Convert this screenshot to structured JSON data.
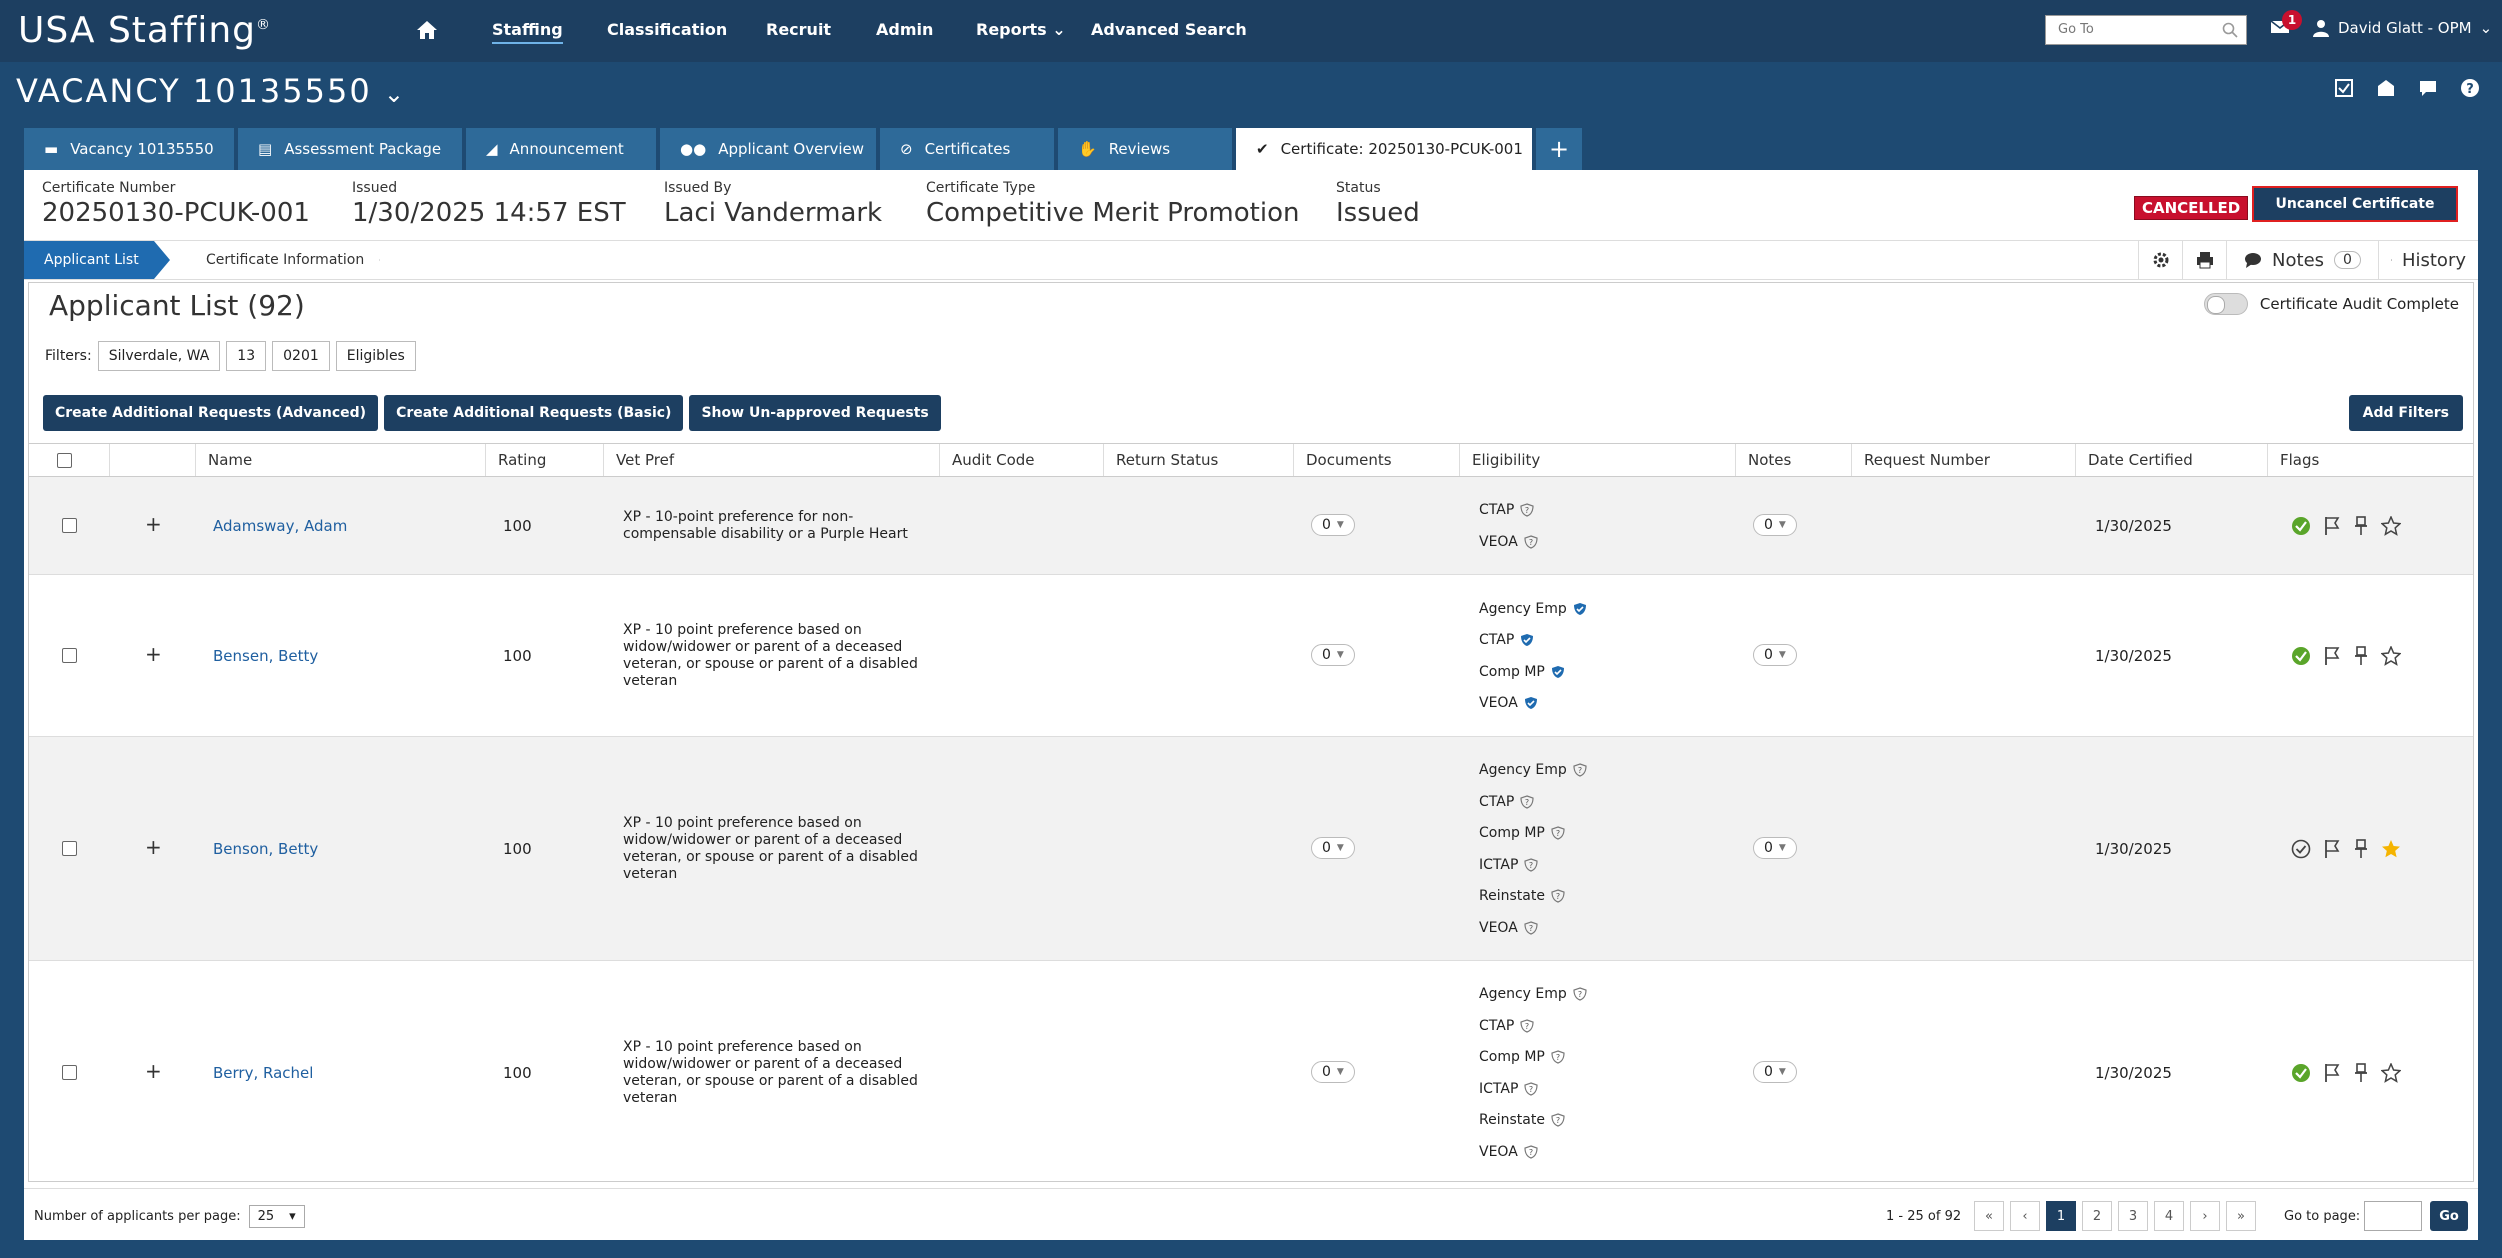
{
  "app": {
    "logo": "USA Staffing",
    "logo_mark": "®"
  },
  "nav": {
    "items": [
      "Staffing",
      "Classification",
      "Recruit",
      "Admin",
      "Reports",
      "Advanced Search"
    ],
    "goto_placeholder": "Go To",
    "mail_count": "1",
    "user": "David Glatt - OPM"
  },
  "vacancy": {
    "title": "VACANCY 10135550"
  },
  "tabs": [
    "Vacancy 10135550",
    "Assessment Package",
    "Announcement",
    "Applicant Overview",
    "Certificates",
    "Reviews",
    "Certificate: 20250130-PCUK-001",
    "+"
  ],
  "cert": {
    "number_label": "Certificate Number",
    "number": "20250130-PCUK-001",
    "issued_label": "Issued",
    "issued": "1/30/2025 14:57 EST",
    "issued_by_label": "Issued By",
    "issued_by": "Laci Vandermark",
    "type_label": "Certificate Type",
    "type": "Competitive Merit Promotion",
    "status_label": "Status",
    "status": "Issued",
    "cancelled_badge": "CANCELLED",
    "uncancel_button": "Uncancel Certificate"
  },
  "crumbs": {
    "active": "Applicant List",
    "second": "Certificate Information",
    "notes_label": "Notes",
    "notes_count": "0",
    "history_label": "History"
  },
  "list": {
    "title": "Applicant List (92)",
    "audit_label": "Certificate Audit Complete",
    "filters_label": "Filters:",
    "filters": [
      "Silverdale, WA",
      "13",
      "0201",
      "Eligibles"
    ],
    "buttons": [
      "Create Additional Requests (Advanced)",
      "Create Additional Requests (Basic)",
      "Show Un-approved Requests"
    ],
    "add_filters": "Add Filters"
  },
  "table": {
    "headers": [
      "Name",
      "Rating",
      "Vet Pref",
      "Audit Code",
      "Return Status",
      "Documents",
      "Eligibility",
      "Notes",
      "Request Number",
      "Date Certified",
      "Flags"
    ],
    "rows": [
      {
        "name": "Adamsway, Adam",
        "rating": "100",
        "vet_pref": "XP - 10-point preference for non-compensable disability or a Purple Heart",
        "documents": "0",
        "eligibility": [
          "CTAP",
          "VEOA"
        ],
        "verified": [
          false,
          false
        ],
        "notes": "0",
        "date": "1/30/2025",
        "status_check": "filled",
        "star": "outline"
      },
      {
        "name": "Bensen, Betty",
        "rating": "100",
        "vet_pref": "XP - 10 point preference based on widow/widower or parent of a deceased veteran, or spouse or parent of a disabled veteran",
        "documents": "0",
        "eligibility": [
          "Agency Emp",
          "CTAP",
          "Comp MP",
          "VEOA"
        ],
        "verified": [
          true,
          true,
          true,
          true
        ],
        "notes": "0",
        "date": "1/30/2025",
        "status_check": "filled",
        "star": "outline"
      },
      {
        "name": "Benson, Betty",
        "rating": "100",
        "vet_pref": "XP - 10 point preference based on widow/widower or parent of a deceased veteran, or spouse or parent of a disabled veteran",
        "documents": "0",
        "eligibility": [
          "Agency Emp",
          "CTAP",
          "Comp MP",
          "ICTAP",
          "Reinstate",
          "VEOA"
        ],
        "verified": [
          false,
          false,
          false,
          false,
          false,
          false
        ],
        "notes": "0",
        "date": "1/30/2025",
        "status_check": "outline",
        "star": "filled"
      },
      {
        "name": "Berry, Rachel",
        "rating": "100",
        "vet_pref": "XP - 10 point preference based on widow/widower or parent of a deceased veteran, or spouse or parent of a disabled veteran",
        "documents": "0",
        "eligibility": [
          "Agency Emp",
          "CTAP",
          "Comp MP",
          "ICTAP",
          "Reinstate",
          "VEOA"
        ],
        "verified": [
          false,
          false,
          false,
          false,
          false,
          false
        ],
        "notes": "0",
        "date": "1/30/2025",
        "status_check": "filled",
        "star": "outline"
      }
    ]
  },
  "pager": {
    "per_page_label": "Number of applicants per page:",
    "per_page": "25",
    "range": "1 - 25 of 92",
    "pages": [
      "1",
      "2",
      "3",
      "4"
    ],
    "goto_label": "Go to page:",
    "go": "Go"
  },
  "colors": {
    "navy": "#1d3f61",
    "tab_blue": "#2e6a99",
    "link": "#1f5fa0",
    "check_green": "#5aa52a",
    "star_gold": "#f5b400",
    "cancel_red": "#c8102e"
  }
}
